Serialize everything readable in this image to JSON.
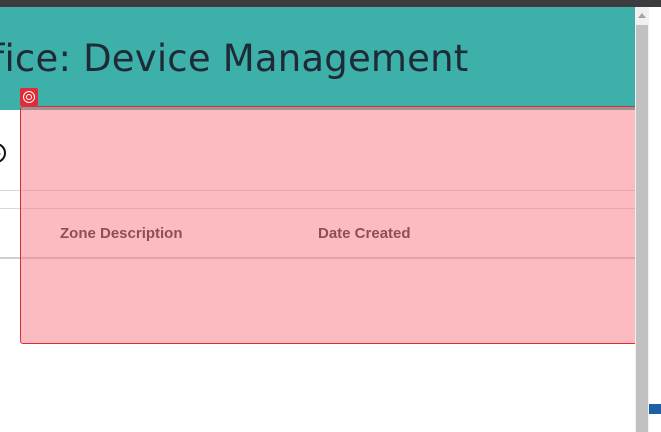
{
  "window": {
    "title": "ffice: Device Management"
  },
  "table": {
    "columns": [
      "Zone Description",
      "Date Created"
    ]
  },
  "icons": {
    "partial_circle": "chevron-circle-icon",
    "overlay_badge": "target-icon",
    "scroll_up": "arrow-up-icon"
  },
  "colors": {
    "header": "#3cb0a9",
    "title_text": "#1f2a36",
    "overlay": "#e22b37"
  }
}
